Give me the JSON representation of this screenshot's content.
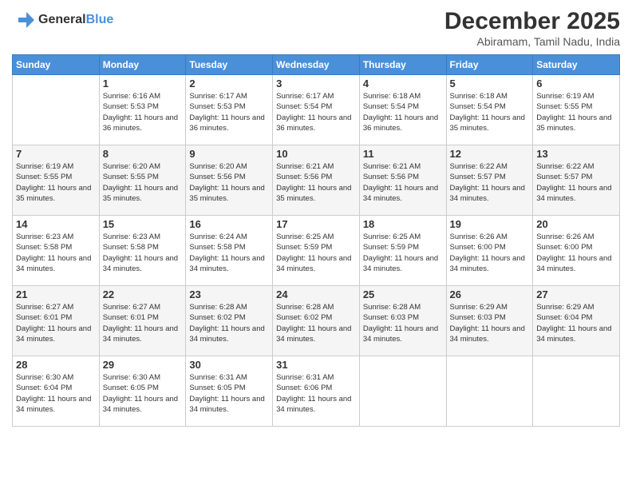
{
  "header": {
    "logo_general": "General",
    "logo_blue": "Blue",
    "month_title": "December 2025",
    "location": "Abiramam, Tamil Nadu, India"
  },
  "weekdays": [
    "Sunday",
    "Monday",
    "Tuesday",
    "Wednesday",
    "Thursday",
    "Friday",
    "Saturday"
  ],
  "weeks": [
    [
      {
        "day": "",
        "sunrise": "",
        "sunset": "",
        "daylight": ""
      },
      {
        "day": "1",
        "sunrise": "Sunrise: 6:16 AM",
        "sunset": "Sunset: 5:53 PM",
        "daylight": "Daylight: 11 hours and 36 minutes."
      },
      {
        "day": "2",
        "sunrise": "Sunrise: 6:17 AM",
        "sunset": "Sunset: 5:53 PM",
        "daylight": "Daylight: 11 hours and 36 minutes."
      },
      {
        "day": "3",
        "sunrise": "Sunrise: 6:17 AM",
        "sunset": "Sunset: 5:54 PM",
        "daylight": "Daylight: 11 hours and 36 minutes."
      },
      {
        "day": "4",
        "sunrise": "Sunrise: 6:18 AM",
        "sunset": "Sunset: 5:54 PM",
        "daylight": "Daylight: 11 hours and 36 minutes."
      },
      {
        "day": "5",
        "sunrise": "Sunrise: 6:18 AM",
        "sunset": "Sunset: 5:54 PM",
        "daylight": "Daylight: 11 hours and 35 minutes."
      },
      {
        "day": "6",
        "sunrise": "Sunrise: 6:19 AM",
        "sunset": "Sunset: 5:55 PM",
        "daylight": "Daylight: 11 hours and 35 minutes."
      }
    ],
    [
      {
        "day": "7",
        "sunrise": "Sunrise: 6:19 AM",
        "sunset": "Sunset: 5:55 PM",
        "daylight": "Daylight: 11 hours and 35 minutes."
      },
      {
        "day": "8",
        "sunrise": "Sunrise: 6:20 AM",
        "sunset": "Sunset: 5:55 PM",
        "daylight": "Daylight: 11 hours and 35 minutes."
      },
      {
        "day": "9",
        "sunrise": "Sunrise: 6:20 AM",
        "sunset": "Sunset: 5:56 PM",
        "daylight": "Daylight: 11 hours and 35 minutes."
      },
      {
        "day": "10",
        "sunrise": "Sunrise: 6:21 AM",
        "sunset": "Sunset: 5:56 PM",
        "daylight": "Daylight: 11 hours and 35 minutes."
      },
      {
        "day": "11",
        "sunrise": "Sunrise: 6:21 AM",
        "sunset": "Sunset: 5:56 PM",
        "daylight": "Daylight: 11 hours and 34 minutes."
      },
      {
        "day": "12",
        "sunrise": "Sunrise: 6:22 AM",
        "sunset": "Sunset: 5:57 PM",
        "daylight": "Daylight: 11 hours and 34 minutes."
      },
      {
        "day": "13",
        "sunrise": "Sunrise: 6:22 AM",
        "sunset": "Sunset: 5:57 PM",
        "daylight": "Daylight: 11 hours and 34 minutes."
      }
    ],
    [
      {
        "day": "14",
        "sunrise": "Sunrise: 6:23 AM",
        "sunset": "Sunset: 5:58 PM",
        "daylight": "Daylight: 11 hours and 34 minutes."
      },
      {
        "day": "15",
        "sunrise": "Sunrise: 6:23 AM",
        "sunset": "Sunset: 5:58 PM",
        "daylight": "Daylight: 11 hours and 34 minutes."
      },
      {
        "day": "16",
        "sunrise": "Sunrise: 6:24 AM",
        "sunset": "Sunset: 5:58 PM",
        "daylight": "Daylight: 11 hours and 34 minutes."
      },
      {
        "day": "17",
        "sunrise": "Sunrise: 6:25 AM",
        "sunset": "Sunset: 5:59 PM",
        "daylight": "Daylight: 11 hours and 34 minutes."
      },
      {
        "day": "18",
        "sunrise": "Sunrise: 6:25 AM",
        "sunset": "Sunset: 5:59 PM",
        "daylight": "Daylight: 11 hours and 34 minutes."
      },
      {
        "day": "19",
        "sunrise": "Sunrise: 6:26 AM",
        "sunset": "Sunset: 6:00 PM",
        "daylight": "Daylight: 11 hours and 34 minutes."
      },
      {
        "day": "20",
        "sunrise": "Sunrise: 6:26 AM",
        "sunset": "Sunset: 6:00 PM",
        "daylight": "Daylight: 11 hours and 34 minutes."
      }
    ],
    [
      {
        "day": "21",
        "sunrise": "Sunrise: 6:27 AM",
        "sunset": "Sunset: 6:01 PM",
        "daylight": "Daylight: 11 hours and 34 minutes."
      },
      {
        "day": "22",
        "sunrise": "Sunrise: 6:27 AM",
        "sunset": "Sunset: 6:01 PM",
        "daylight": "Daylight: 11 hours and 34 minutes."
      },
      {
        "day": "23",
        "sunrise": "Sunrise: 6:28 AM",
        "sunset": "Sunset: 6:02 PM",
        "daylight": "Daylight: 11 hours and 34 minutes."
      },
      {
        "day": "24",
        "sunrise": "Sunrise: 6:28 AM",
        "sunset": "Sunset: 6:02 PM",
        "daylight": "Daylight: 11 hours and 34 minutes."
      },
      {
        "day": "25",
        "sunrise": "Sunrise: 6:28 AM",
        "sunset": "Sunset: 6:03 PM",
        "daylight": "Daylight: 11 hours and 34 minutes."
      },
      {
        "day": "26",
        "sunrise": "Sunrise: 6:29 AM",
        "sunset": "Sunset: 6:03 PM",
        "daylight": "Daylight: 11 hours and 34 minutes."
      },
      {
        "day": "27",
        "sunrise": "Sunrise: 6:29 AM",
        "sunset": "Sunset: 6:04 PM",
        "daylight": "Daylight: 11 hours and 34 minutes."
      }
    ],
    [
      {
        "day": "28",
        "sunrise": "Sunrise: 6:30 AM",
        "sunset": "Sunset: 6:04 PM",
        "daylight": "Daylight: 11 hours and 34 minutes."
      },
      {
        "day": "29",
        "sunrise": "Sunrise: 6:30 AM",
        "sunset": "Sunset: 6:05 PM",
        "daylight": "Daylight: 11 hours and 34 minutes."
      },
      {
        "day": "30",
        "sunrise": "Sunrise: 6:31 AM",
        "sunset": "Sunset: 6:05 PM",
        "daylight": "Daylight: 11 hours and 34 minutes."
      },
      {
        "day": "31",
        "sunrise": "Sunrise: 6:31 AM",
        "sunset": "Sunset: 6:06 PM",
        "daylight": "Daylight: 11 hours and 34 minutes."
      },
      {
        "day": "",
        "sunrise": "",
        "sunset": "",
        "daylight": ""
      },
      {
        "day": "",
        "sunrise": "",
        "sunset": "",
        "daylight": ""
      },
      {
        "day": "",
        "sunrise": "",
        "sunset": "",
        "daylight": ""
      }
    ]
  ]
}
